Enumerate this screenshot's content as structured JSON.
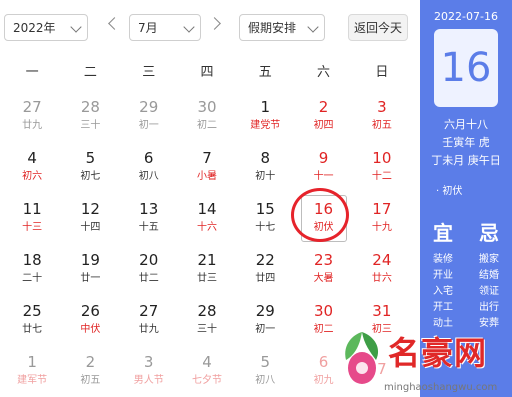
{
  "toolbar": {
    "year": "2022年",
    "month": "7月",
    "holiday": "假期安排",
    "today_label": "返回今天"
  },
  "weekdays": [
    "一",
    "二",
    "三",
    "四",
    "五",
    "六",
    "日"
  ],
  "weeks": [
    [
      {
        "day": "27",
        "lunar": "廿九",
        "other": true
      },
      {
        "day": "28",
        "lunar": "三十",
        "other": true
      },
      {
        "day": "29",
        "lunar": "初一",
        "other": true
      },
      {
        "day": "30",
        "lunar": "初二",
        "other": true
      },
      {
        "day": "1",
        "lunar": "建党节",
        "lunarRed": true
      },
      {
        "day": "2",
        "lunar": "初四",
        "red": true
      },
      {
        "day": "3",
        "lunar": "初五",
        "red": true
      }
    ],
    [
      {
        "day": "4",
        "lunar": "初六",
        "lunarRed": true
      },
      {
        "day": "5",
        "lunar": "初七"
      },
      {
        "day": "6",
        "lunar": "初八"
      },
      {
        "day": "7",
        "lunar": "小暑",
        "lunarRed": true
      },
      {
        "day": "8",
        "lunar": "初十"
      },
      {
        "day": "9",
        "lunar": "十一",
        "red": true
      },
      {
        "day": "10",
        "lunar": "十二",
        "red": true
      }
    ],
    [
      {
        "day": "11",
        "lunar": "十三",
        "lunarRed": true
      },
      {
        "day": "12",
        "lunar": "十四"
      },
      {
        "day": "13",
        "lunar": "十五"
      },
      {
        "day": "14",
        "lunar": "十六",
        "lunarRed": true
      },
      {
        "day": "15",
        "lunar": "十七"
      },
      {
        "day": "16",
        "lunar": "初伏",
        "red": true,
        "selected": true
      },
      {
        "day": "17",
        "lunar": "十九",
        "red": true
      }
    ],
    [
      {
        "day": "18",
        "lunar": "二十"
      },
      {
        "day": "19",
        "lunar": "廿一"
      },
      {
        "day": "20",
        "lunar": "廿二"
      },
      {
        "day": "21",
        "lunar": "廿三"
      },
      {
        "day": "22",
        "lunar": "廿四"
      },
      {
        "day": "23",
        "lunar": "大暑",
        "red": true
      },
      {
        "day": "24",
        "lunar": "廿六",
        "red": true
      }
    ],
    [
      {
        "day": "25",
        "lunar": "廿七"
      },
      {
        "day": "26",
        "lunar": "中伏",
        "lunarRed": true
      },
      {
        "day": "27",
        "lunar": "廿九"
      },
      {
        "day": "28",
        "lunar": "三十"
      },
      {
        "day": "29",
        "lunar": "初一"
      },
      {
        "day": "30",
        "lunar": "初二",
        "red": true
      },
      {
        "day": "31",
        "lunar": "初三",
        "red": true
      }
    ],
    [
      {
        "day": "1",
        "lunar": "建军节",
        "other": true,
        "lunarRed": true
      },
      {
        "day": "2",
        "lunar": "初五",
        "other": true
      },
      {
        "day": "3",
        "lunar": "男人节",
        "other": true,
        "lunarRed": true
      },
      {
        "day": "4",
        "lunar": "七夕节",
        "other": true,
        "lunarRed": true
      },
      {
        "day": "5",
        "lunar": "初八",
        "other": true
      },
      {
        "day": "6",
        "lunar": "初九",
        "other": true,
        "red": true
      },
      {
        "day": "7",
        "lunar": "",
        "other": true,
        "red": true
      }
    ]
  ],
  "panel": {
    "date": "2022-07-16",
    "day": "16",
    "lunar_date": "六月十八",
    "year_gz": "壬寅年 虎",
    "month_day_gz": "丁未月 庚午日",
    "festival": "· 初伏",
    "yi_label": "宜",
    "ji_label": "忌",
    "yi": [
      "装修",
      "开业",
      "入宅",
      "开工",
      "动土"
    ],
    "ji": [
      "搬家",
      "结婚",
      "领证",
      "出行",
      "安葬"
    ]
  },
  "watermark": {
    "brand": "名豪网",
    "url": "minghaoshangwu.com"
  },
  "colors": {
    "accent": "#5b7de8",
    "holiday_red": "#e02424",
    "circle": "#e6232b"
  }
}
